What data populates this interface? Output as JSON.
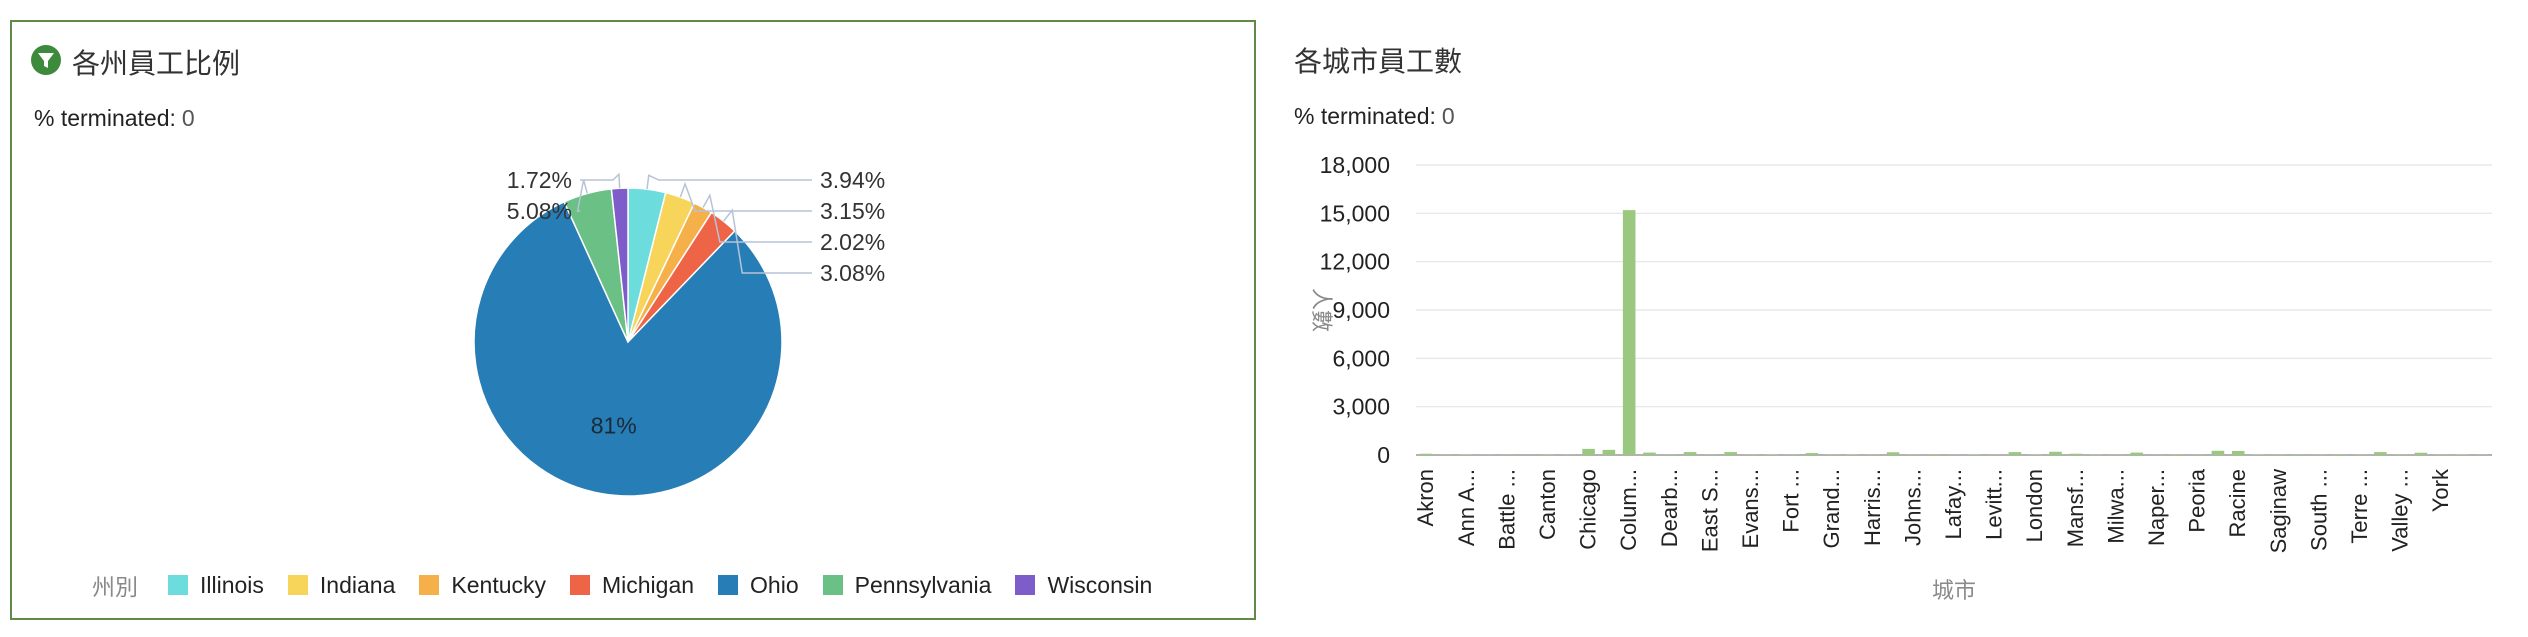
{
  "left_panel": {
    "title": "各州員工比例",
    "filter_label": "% terminated:",
    "filter_value": "0",
    "icon": "filter-icon",
    "legend_title": "州別"
  },
  "right_panel": {
    "title": "各城市員工數",
    "filter_label": "% terminated:",
    "filter_value": "0"
  },
  "chart_data": [
    {
      "type": "pie",
      "title": "各州員工比例",
      "legend_title": "州別",
      "legend_placement": "bottom",
      "slices": [
        {
          "name": "Illinois",
          "value": 3.94,
          "label": "3.94%",
          "color": "#6ddcdc"
        },
        {
          "name": "Indiana",
          "value": 3.15,
          "label": "3.15%",
          "color": "#f7d45a"
        },
        {
          "name": "Kentucky",
          "value": 2.02,
          "label": "2.02%",
          "color": "#f5b04a"
        },
        {
          "name": "Michigan",
          "value": 3.08,
          "label": "3.08%",
          "color": "#ee6447"
        },
        {
          "name": "Ohio",
          "value": 81.0,
          "label": "81%",
          "color": "#277db5"
        },
        {
          "name": "Pennsylvania",
          "value": 5.08,
          "label": "5.08%",
          "color": "#6bc085"
        },
        {
          "name": "Wisconsin",
          "value": 1.72,
          "label": "1.72%",
          "color": "#7e5cc9"
        }
      ]
    },
    {
      "type": "bar",
      "title": "各城市員工數",
      "xlabel": "城市",
      "ylabel": "人數",
      "ylim": [
        0,
        18000
      ],
      "yticks": [
        0,
        3000,
        6000,
        9000,
        12000,
        15000,
        18000
      ],
      "ytick_labels": [
        "0",
        "3,000",
        "6,000",
        "9,000",
        "12,000",
        "15,000",
        "18,000"
      ],
      "grid": true,
      "bar_color": "#9bc87f",
      "categories": [
        "Akron",
        "",
        "Ann A...",
        "",
        "Battle ...",
        "",
        "Canton",
        "",
        "Chicago",
        "",
        "Colum...",
        "",
        "Dearb...",
        "",
        "East S...",
        "",
        "Evans...",
        "",
        "Fort ...",
        "",
        "Grand...",
        "",
        "Harris...",
        "",
        "Johns...",
        "",
        "Lafay...",
        "",
        "Levitt...",
        "",
        "London",
        "",
        "Mansf...",
        "",
        "Milwa...",
        "",
        "Naper...",
        "",
        "Peoria",
        "",
        "Racine",
        "",
        "Saginaw",
        "",
        "South ...",
        "",
        "Terre ...",
        "",
        "Valley ...",
        "",
        "York"
      ],
      "values": [
        80,
        20,
        30,
        20,
        20,
        15,
        25,
        20,
        380,
        320,
        15200,
        150,
        40,
        180,
        20,
        180,
        20,
        30,
        20,
        120,
        20,
        30,
        20,
        170,
        20,
        40,
        20,
        30,
        20,
        180,
        30,
        200,
        80,
        30,
        20,
        150,
        20,
        40,
        20,
        260,
        250,
        30,
        20,
        40,
        20,
        40,
        20,
        180,
        20,
        140,
        20,
        30,
        20
      ]
    }
  ]
}
